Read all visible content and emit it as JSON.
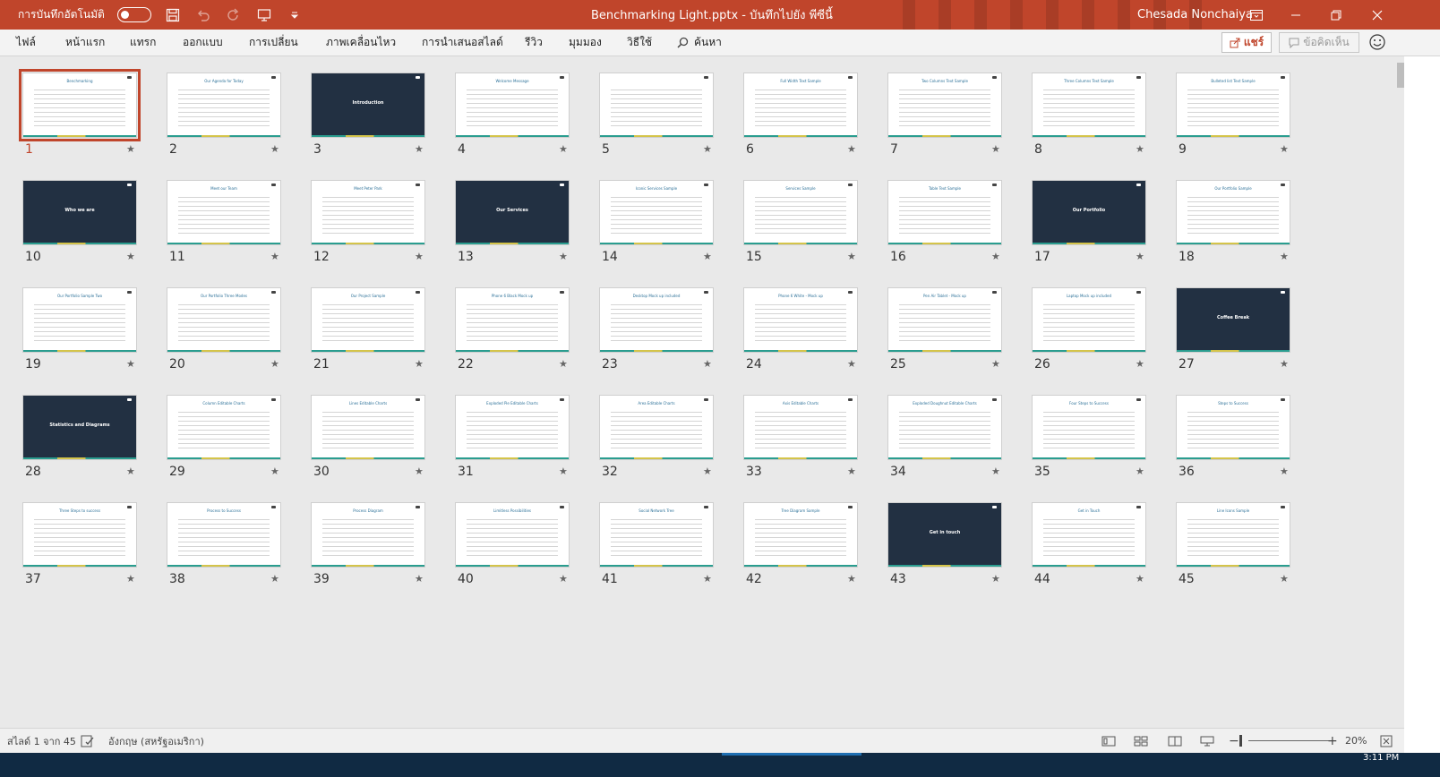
{
  "titlebar": {
    "autosave_label": "การบันทึกอัตโนมัติ",
    "document_title": "Benchmarking Light.pptx  -  บันทึกไปยัง พีซีนี้",
    "user_name": "Chesada Nonchaiya"
  },
  "ribbon": {
    "tabs": [
      "ไฟล์",
      "หน้าแรก",
      "แทรก",
      "ออกแบบ",
      "การเปลี่ยน",
      "ภาพเคลื่อนไหว",
      "การนำเสนอสไลด์",
      "รีวิว",
      "มุมมอง",
      "วิธีใช้",
      "ค้นหา"
    ],
    "share_label": "แชร์",
    "comments_label": "ข้อคิดเห็น"
  },
  "slides": [
    {
      "n": "1",
      "title": "Benchmarking",
      "dark": false
    },
    {
      "n": "2",
      "title": "Our Agenda for Today",
      "dark": false
    },
    {
      "n": "3",
      "title": "Introduction",
      "dark": true
    },
    {
      "n": "4",
      "title": "Welcome Message",
      "dark": false
    },
    {
      "n": "5",
      "title": "",
      "dark": false
    },
    {
      "n": "6",
      "title": "Full Width Text Sample",
      "dark": false
    },
    {
      "n": "7",
      "title": "Two Columns Text Sample",
      "dark": false
    },
    {
      "n": "8",
      "title": "Three Columns Text Sample",
      "dark": false
    },
    {
      "n": "9",
      "title": "Bulleted list Text Sample",
      "dark": false
    },
    {
      "n": "10",
      "title": "Who we are",
      "dark": true
    },
    {
      "n": "11",
      "title": "Meet our Team",
      "dark": false
    },
    {
      "n": "12",
      "title": "Meet Peter Park",
      "dark": false
    },
    {
      "n": "13",
      "title": "Our Services",
      "dark": true
    },
    {
      "n": "14",
      "title": "Iconic Services Sample",
      "dark": false
    },
    {
      "n": "15",
      "title": "Services Sample",
      "dark": false
    },
    {
      "n": "16",
      "title": "Table Text Sample",
      "dark": false
    },
    {
      "n": "17",
      "title": "Our Portfolio",
      "dark": true
    },
    {
      "n": "18",
      "title": "Our Portfolio Sample",
      "dark": false
    },
    {
      "n": "19",
      "title": "Our Portfolio Sample Two",
      "dark": false
    },
    {
      "n": "20",
      "title": "Our Portfolio Three Modes",
      "dark": false
    },
    {
      "n": "21",
      "title": "Our Project Sample",
      "dark": false
    },
    {
      "n": "22",
      "title": "Phone 6 Black Mock up",
      "dark": false
    },
    {
      "n": "23",
      "title": "Desktop Mock up included",
      "dark": false
    },
    {
      "n": "24",
      "title": "Phone 6 White - Mock up",
      "dark": false
    },
    {
      "n": "25",
      "title": "Pen Air Tablet - Mock up",
      "dark": false
    },
    {
      "n": "26",
      "title": "Laptop Mock up included",
      "dark": false
    },
    {
      "n": "27",
      "title": "Coffee Break",
      "dark": true
    },
    {
      "n": "28",
      "title": "Statistics and Diagrams",
      "dark": true
    },
    {
      "n": "29",
      "title": "Column Editable Charts",
      "dark": false
    },
    {
      "n": "30",
      "title": "Lines Editable Charts",
      "dark": false
    },
    {
      "n": "31",
      "title": "Exploded Pie Editable Charts",
      "dark": false
    },
    {
      "n": "32",
      "title": "Area Editable Charts",
      "dark": false
    },
    {
      "n": "33",
      "title": "Axis Editable Charts",
      "dark": false
    },
    {
      "n": "34",
      "title": "Exploded Doughnut Editable Charts",
      "dark": false
    },
    {
      "n": "35",
      "title": "Four Steps to Success",
      "dark": false
    },
    {
      "n": "36",
      "title": "Steps to Success",
      "dark": false
    },
    {
      "n": "37",
      "title": "Three Steps to success",
      "dark": false
    },
    {
      "n": "38",
      "title": "Process to Success",
      "dark": false
    },
    {
      "n": "39",
      "title": "Process Diagram",
      "dark": false
    },
    {
      "n": "40",
      "title": "Limitless Possibilities",
      "dark": false
    },
    {
      "n": "41",
      "title": "Social Network Tree",
      "dark": false
    },
    {
      "n": "42",
      "title": "Tree Diagram Sample",
      "dark": false
    },
    {
      "n": "43",
      "title": "Get in touch",
      "dark": true
    },
    {
      "n": "44",
      "title": "Get in Touch",
      "dark": false
    },
    {
      "n": "45",
      "title": "Line Icons Sample",
      "dark": false
    }
  ],
  "selected_slide": "1",
  "star_glyph": "★",
  "status": {
    "slide_counter": "สไลด์ 1 จาก 45",
    "language": "อังกฤษ (สหรัฐอเมริกา)",
    "zoom": "20%",
    "clock": "3:11 PM"
  },
  "colors": {
    "accent": "#c0452b",
    "dark_slide": "#223042",
    "teal": "#2a9d8f"
  }
}
